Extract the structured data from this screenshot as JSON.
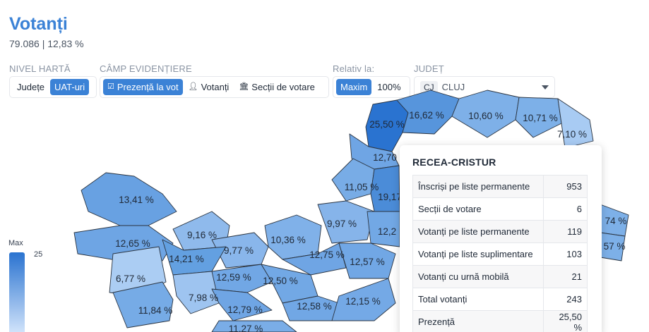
{
  "header": {
    "title": "Votanți",
    "summary": "79.086 | 12,83 %"
  },
  "controls": {
    "map_level": {
      "label": "NIVEL HARTĂ",
      "options": [
        "Județe",
        "UAT-uri"
      ],
      "selected": "UAT-uri"
    },
    "highlight_field": {
      "label": "CÂMP EVIDENȚIERE",
      "options": [
        "Prezență la vot",
        "Votanți",
        "Secții de votare"
      ],
      "selected": "Prezență la vot"
    },
    "relative_to": {
      "label": "Relativ la:",
      "options": [
        "Maxim",
        "100%"
      ],
      "selected": "Maxim"
    },
    "county": {
      "label": "JUDEȚ",
      "code": "CJ",
      "value": "CLUJ"
    }
  },
  "map": {
    "regions": [
      {
        "label": "25,50 %",
        "color": "#2a73d0"
      },
      {
        "label": "16,62 %",
        "color": "#5795dc"
      },
      {
        "label": "10,60 %",
        "color": "#7eb0e8"
      },
      {
        "label": "10,71 %",
        "color": "#7db0e8"
      },
      {
        "label": "7,10 %",
        "color": "#a8cbf3"
      },
      {
        "label": "12,70",
        "color": "#6fa5e4"
      },
      {
        "label": "13,41 %",
        "color": "#68a1e2"
      },
      {
        "label": "11,05 %",
        "color": "#78ace6"
      },
      {
        "label": "19,17",
        "color": "#4b8cd8"
      },
      {
        "label": "12,65 %",
        "color": "#6ea5e4"
      },
      {
        "label": "9,16 %",
        "color": "#8fbaec"
      },
      {
        "label": "9,97 %",
        "color": "#86b4ea"
      },
      {
        "label": "12,2",
        "color": "#72a8e5"
      },
      {
        "label": "10,36 %",
        "color": "#80b1e9"
      },
      {
        "label": "9,77 %",
        "color": "#89b6eb"
      },
      {
        "label": "14,21 %",
        "color": "#63a0e1"
      },
      {
        "label": "12,75 %",
        "color": "#6fa5e4"
      },
      {
        "label": "12,57 %",
        "color": "#71a7e5"
      },
      {
        "label": "6,77 %",
        "color": "#abcdf3"
      },
      {
        "label": "12,59 %",
        "color": "#71a7e5"
      },
      {
        "label": "12,50 %",
        "color": "#72a8e5"
      },
      {
        "label": "7,98 %",
        "color": "#9ec4f0"
      },
      {
        "label": "12,79 %",
        "color": "#6fa5e4"
      },
      {
        "label": "12,58 %",
        "color": "#71a7e5"
      },
      {
        "label": "12,15 %",
        "color": "#74a9e6"
      },
      {
        "label": "11,84 %",
        "color": "#76abe6"
      },
      {
        "label": "11,27 %",
        "color": "#7aade7"
      },
      {
        "label": "74 %",
        "color": "#7db0e8"
      },
      {
        "label": "57 %",
        "color": "#7db0e8"
      }
    ]
  },
  "legend": {
    "max_label": "Max",
    "max_value": "25"
  },
  "tooltip": {
    "title": "RECEA-CRISTUR",
    "rows": [
      {
        "label": "Înscriși pe liste permanente",
        "value": "953"
      },
      {
        "label": "Secții de votare",
        "value": "6"
      },
      {
        "label": "Votanți pe liste permanente",
        "value": "119"
      },
      {
        "label": "Votanți pe liste suplimentare",
        "value": "103"
      },
      {
        "label": "Votanți cu urnă mobilă",
        "value": "21"
      },
      {
        "label": "Total votanți",
        "value": "243"
      },
      {
        "label": "Prezență",
        "value": "25,50 %"
      }
    ]
  }
}
